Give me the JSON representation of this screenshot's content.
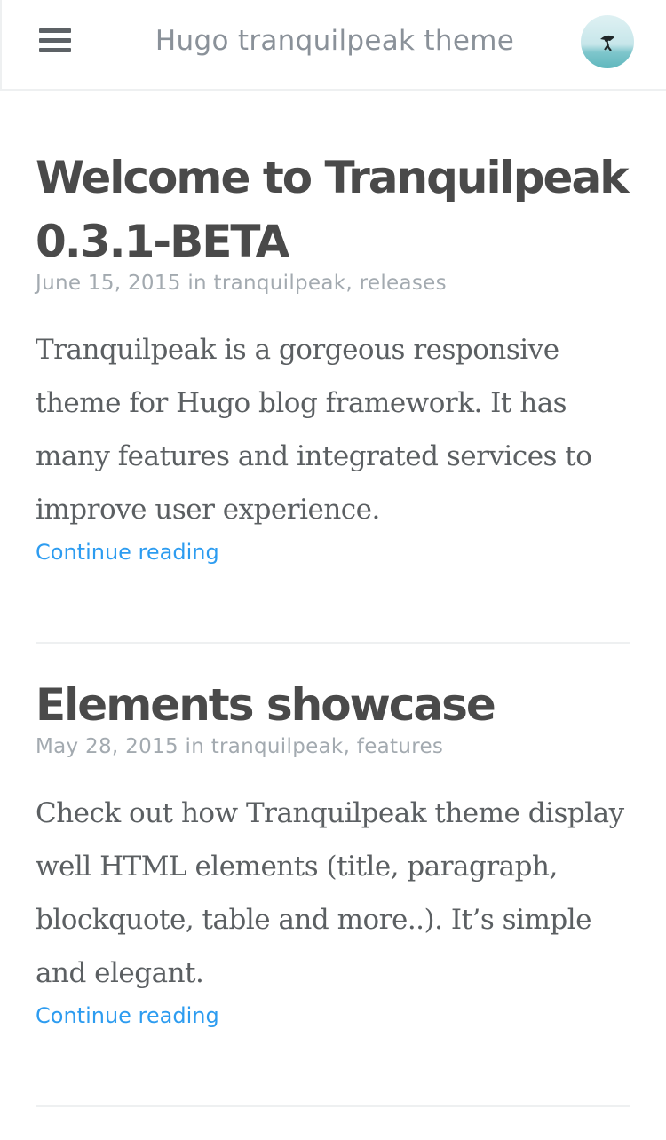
{
  "header": {
    "menu_icon": "hamburger-menu-icon",
    "blog_title": "Hugo tranquilpeak theme",
    "avatar_icon": "author-avatar"
  },
  "posts": [
    {
      "title_line1": "Welcome to Tranquilpeak",
      "title_line2": "0.3.1-BETA",
      "date": "June 15, 2015",
      "in": " in ",
      "category1": "tranquilpeak",
      "sep": ", ",
      "category2": "releases",
      "excerpt_lines": [
        "Tranquilpeak is a gorgeous responsive",
        "theme for Hugo blog framework. It has",
        "many features and integrated services to",
        "improve user experience."
      ],
      "continue_label": "Continue reading"
    },
    {
      "title_line1": "Elements showcase",
      "date": "May 28, 2015",
      "in": " in ",
      "category1": "tranquilpeak",
      "sep": ", ",
      "category2": "features",
      "excerpt_lines": [
        "Check out how Tranquilpeak theme display",
        "well HTML elements (title, paragraph,",
        "blockquote, table and more..). It’s simple",
        "and elegant."
      ],
      "continue_label": "Continue reading"
    }
  ],
  "colors": {
    "link": "#2d9cf0",
    "meta": "#a3aab0",
    "title": "#4a4a4a"
  }
}
